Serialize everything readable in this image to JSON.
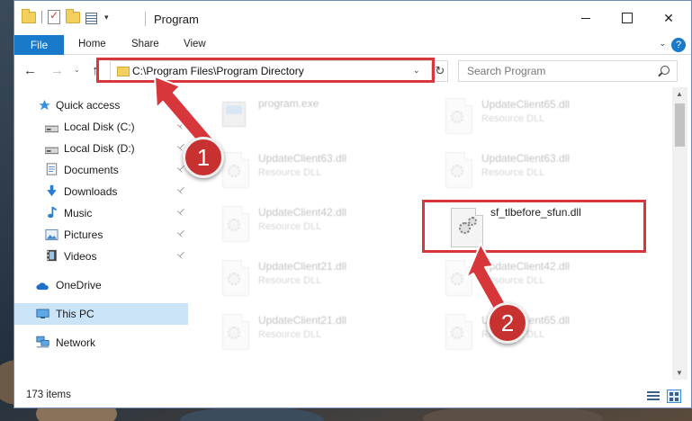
{
  "window": {
    "title": "Program",
    "controls": {
      "minimize": "minimize",
      "maximize": "maximize",
      "close": "✕"
    }
  },
  "ribbon": {
    "tabs": [
      "File",
      "Home",
      "Share",
      "View"
    ],
    "help": "?",
    "expand": "⌄"
  },
  "nav": {
    "back": "←",
    "forward": "→",
    "recent": "⌄",
    "up": "↑",
    "address": "C:\\Program Files\\Program Directory",
    "address_dropdown": "⌄",
    "refresh": "↻",
    "search_placeholder": "Search Program"
  },
  "sidebar": {
    "items": [
      {
        "label": "Quick access",
        "icon": "star-icon",
        "pinned": false
      },
      {
        "label": "Local Disk (C:)",
        "icon": "drive-icon",
        "pinned": true
      },
      {
        "label": "Local Disk (D:)",
        "icon": "drive-icon",
        "pinned": true
      },
      {
        "label": "Documents",
        "icon": "documents-icon",
        "pinned": true
      },
      {
        "label": "Downloads",
        "icon": "downloads-icon",
        "pinned": true
      },
      {
        "label": "Music",
        "icon": "music-icon",
        "pinned": true
      },
      {
        "label": "Pictures",
        "icon": "pictures-icon",
        "pinned": true
      },
      {
        "label": "Videos",
        "icon": "videos-icon",
        "pinned": true
      },
      {
        "label": "OneDrive",
        "icon": "cloud-icon",
        "pinned": false
      },
      {
        "label": "This PC",
        "icon": "computer-icon",
        "pinned": false,
        "selected": true
      },
      {
        "label": "Network",
        "icon": "network-icon",
        "pinned": false
      }
    ],
    "pin_glyph": "📌"
  },
  "files": [
    {
      "name": "program.exe",
      "type": "",
      "faded": true,
      "icon": "exe-icon"
    },
    {
      "name": "UpdateClient65.dll",
      "type": "Resource DLL",
      "faded": true,
      "icon": "dll-icon"
    },
    {
      "name": "UpdateClient63.dll",
      "type": "Resource DLL",
      "faded": true,
      "icon": "dll-icon"
    },
    {
      "name": "UpdateClient63.dll",
      "type": "Resource DLL",
      "faded": true,
      "icon": "dll-icon"
    },
    {
      "name": "UpdateClient42.dll",
      "type": "Resource DLL",
      "faded": true,
      "icon": "dll-icon"
    },
    {
      "name": "sf_tlbefore_sfun.dll",
      "type": "",
      "faded": false,
      "icon": "dll-icon"
    },
    {
      "name": "UpdateClient21.dll",
      "type": "Resource DLL",
      "faded": true,
      "icon": "dll-icon"
    },
    {
      "name": "UpdateClient42.dll",
      "type": "Resource DLL",
      "faded": true,
      "icon": "dll-icon"
    },
    {
      "name": "UpdateClient21.dll",
      "type": "Resource DLL",
      "faded": true,
      "icon": "dll-icon"
    },
    {
      "name": "UpdateClient65.dll",
      "type": "Resource DLL",
      "faded": true,
      "icon": "dll-icon"
    }
  ],
  "status": {
    "items_count": "173 items"
  },
  "annotations": {
    "badge1": "1",
    "badge2": "2",
    "color": "#d7373b"
  }
}
